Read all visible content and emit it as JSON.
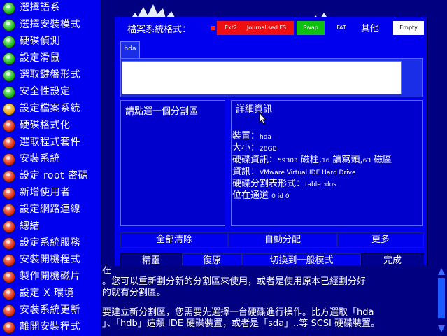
{
  "sidebar": {
    "steps": [
      {
        "label": "選擇語系",
        "state": "done"
      },
      {
        "label": "選擇安裝模式",
        "state": "done"
      },
      {
        "label": "硬碟偵測",
        "state": "done"
      },
      {
        "label": "設定滑鼠",
        "state": "done"
      },
      {
        "label": "選取鍵盤形式",
        "state": "done"
      },
      {
        "label": "安全性設定",
        "state": "done"
      },
      {
        "label": "設定檔案系統",
        "state": "current"
      },
      {
        "label": "硬碟格式化",
        "state": "todo"
      },
      {
        "label": "選取程式套件",
        "state": "todo"
      },
      {
        "label": "安裝系統",
        "state": "todo"
      },
      {
        "label": "設定 root 密碼",
        "state": "todo"
      },
      {
        "label": "新增使用者",
        "state": "todo"
      },
      {
        "label": "設定網路連線",
        "state": "todo"
      },
      {
        "label": "總結",
        "state": "todo"
      },
      {
        "label": "設定系統服務",
        "state": "todo"
      },
      {
        "label": "安裝開機程式",
        "state": "todo"
      },
      {
        "label": "製作開機磁片",
        "state": "todo"
      },
      {
        "label": "設定 X 環境",
        "state": "todo"
      },
      {
        "label": "安裝系統更新",
        "state": "todo"
      },
      {
        "label": "離開安裝程式",
        "state": "todo"
      }
    ]
  },
  "dialog": {
    "fs_title": "檔案系統格式：",
    "fs_types": [
      {
        "label": "Ext2",
        "color": "#ee1010"
      },
      {
        "label": "Journalised FS",
        "color": "#ee1010"
      },
      {
        "label": "Swap",
        "color": "#10c010"
      },
      {
        "label": "FAT",
        "color": "#0000ee"
      },
      {
        "label": "Empty",
        "color": "#ffffff"
      }
    ],
    "fs_other": "其他",
    "disk_tab": "hda",
    "partition_hint": "請點選一個分割區",
    "details": {
      "title": "詳細資訊",
      "device_label": "裝置：",
      "device_value": "hda",
      "size_label": "大小：",
      "size_value": "28GB",
      "geometry_label": "硬碟資訊：",
      "geometry_cyl": "59303",
      "geometry_cyl_unit": "磁柱,",
      "geometry_heads": "16",
      "geometry_heads_unit": "讀寫頭,",
      "geometry_sectors": "63",
      "geometry_sectors_unit": "磁區",
      "info_label": "資訊：",
      "info_value": "VMware Virtual IDE Hard Drive",
      "table_label": "硬碟分割表形式：",
      "table_value": "table::dos",
      "bus_label": "位在通道",
      "bus_value": "0 id 0"
    },
    "buttons_row1": [
      "全部清除",
      "自動分配",
      "更多"
    ],
    "buttons_row2": [
      "精靈",
      "復原",
      "切換到一般模式",
      "完成"
    ]
  },
  "help": {
    "lines": [
      "在",
      "。您可以重新劃分新的分割區來使用，或者是使用原本已經劃分好",
      "的就有分割區。",
      "",
      "要建立新分割區，您需要先選擇一台硬碟進行操作。比方選取「hda",
      "」、「hdb」這類 IDE 硬碟裝置，或者是「sda」..等 SCSI 硬碟裝置。"
    ]
  }
}
